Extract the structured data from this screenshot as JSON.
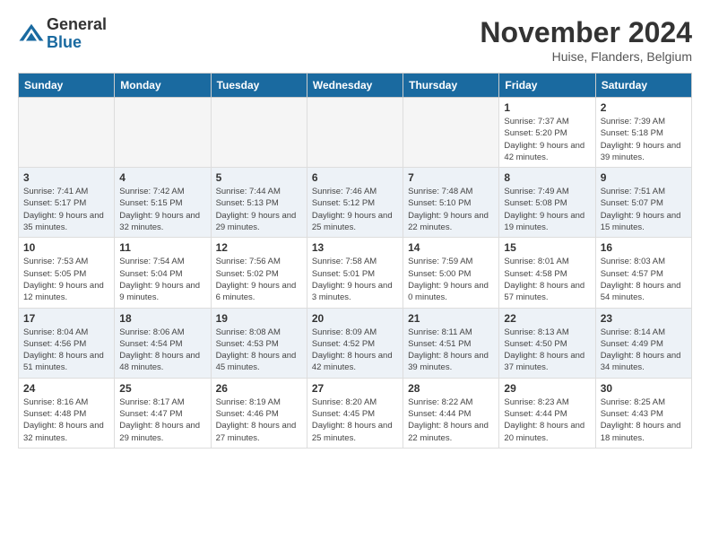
{
  "header": {
    "logo_general": "General",
    "logo_blue": "Blue",
    "month_year": "November 2024",
    "location": "Huise, Flanders, Belgium"
  },
  "weekdays": [
    "Sunday",
    "Monday",
    "Tuesday",
    "Wednesday",
    "Thursday",
    "Friday",
    "Saturday"
  ],
  "weeks": [
    [
      {
        "day": "",
        "info": ""
      },
      {
        "day": "",
        "info": ""
      },
      {
        "day": "",
        "info": ""
      },
      {
        "day": "",
        "info": ""
      },
      {
        "day": "",
        "info": ""
      },
      {
        "day": "1",
        "info": "Sunrise: 7:37 AM\nSunset: 5:20 PM\nDaylight: 9 hours and 42 minutes."
      },
      {
        "day": "2",
        "info": "Sunrise: 7:39 AM\nSunset: 5:18 PM\nDaylight: 9 hours and 39 minutes."
      }
    ],
    [
      {
        "day": "3",
        "info": "Sunrise: 7:41 AM\nSunset: 5:17 PM\nDaylight: 9 hours and 35 minutes."
      },
      {
        "day": "4",
        "info": "Sunrise: 7:42 AM\nSunset: 5:15 PM\nDaylight: 9 hours and 32 minutes."
      },
      {
        "day": "5",
        "info": "Sunrise: 7:44 AM\nSunset: 5:13 PM\nDaylight: 9 hours and 29 minutes."
      },
      {
        "day": "6",
        "info": "Sunrise: 7:46 AM\nSunset: 5:12 PM\nDaylight: 9 hours and 25 minutes."
      },
      {
        "day": "7",
        "info": "Sunrise: 7:48 AM\nSunset: 5:10 PM\nDaylight: 9 hours and 22 minutes."
      },
      {
        "day": "8",
        "info": "Sunrise: 7:49 AM\nSunset: 5:08 PM\nDaylight: 9 hours and 19 minutes."
      },
      {
        "day": "9",
        "info": "Sunrise: 7:51 AM\nSunset: 5:07 PM\nDaylight: 9 hours and 15 minutes."
      }
    ],
    [
      {
        "day": "10",
        "info": "Sunrise: 7:53 AM\nSunset: 5:05 PM\nDaylight: 9 hours and 12 minutes."
      },
      {
        "day": "11",
        "info": "Sunrise: 7:54 AM\nSunset: 5:04 PM\nDaylight: 9 hours and 9 minutes."
      },
      {
        "day": "12",
        "info": "Sunrise: 7:56 AM\nSunset: 5:02 PM\nDaylight: 9 hours and 6 minutes."
      },
      {
        "day": "13",
        "info": "Sunrise: 7:58 AM\nSunset: 5:01 PM\nDaylight: 9 hours and 3 minutes."
      },
      {
        "day": "14",
        "info": "Sunrise: 7:59 AM\nSunset: 5:00 PM\nDaylight: 9 hours and 0 minutes."
      },
      {
        "day": "15",
        "info": "Sunrise: 8:01 AM\nSunset: 4:58 PM\nDaylight: 8 hours and 57 minutes."
      },
      {
        "day": "16",
        "info": "Sunrise: 8:03 AM\nSunset: 4:57 PM\nDaylight: 8 hours and 54 minutes."
      }
    ],
    [
      {
        "day": "17",
        "info": "Sunrise: 8:04 AM\nSunset: 4:56 PM\nDaylight: 8 hours and 51 minutes."
      },
      {
        "day": "18",
        "info": "Sunrise: 8:06 AM\nSunset: 4:54 PM\nDaylight: 8 hours and 48 minutes."
      },
      {
        "day": "19",
        "info": "Sunrise: 8:08 AM\nSunset: 4:53 PM\nDaylight: 8 hours and 45 minutes."
      },
      {
        "day": "20",
        "info": "Sunrise: 8:09 AM\nSunset: 4:52 PM\nDaylight: 8 hours and 42 minutes."
      },
      {
        "day": "21",
        "info": "Sunrise: 8:11 AM\nSunset: 4:51 PM\nDaylight: 8 hours and 39 minutes."
      },
      {
        "day": "22",
        "info": "Sunrise: 8:13 AM\nSunset: 4:50 PM\nDaylight: 8 hours and 37 minutes."
      },
      {
        "day": "23",
        "info": "Sunrise: 8:14 AM\nSunset: 4:49 PM\nDaylight: 8 hours and 34 minutes."
      }
    ],
    [
      {
        "day": "24",
        "info": "Sunrise: 8:16 AM\nSunset: 4:48 PM\nDaylight: 8 hours and 32 minutes."
      },
      {
        "day": "25",
        "info": "Sunrise: 8:17 AM\nSunset: 4:47 PM\nDaylight: 8 hours and 29 minutes."
      },
      {
        "day": "26",
        "info": "Sunrise: 8:19 AM\nSunset: 4:46 PM\nDaylight: 8 hours and 27 minutes."
      },
      {
        "day": "27",
        "info": "Sunrise: 8:20 AM\nSunset: 4:45 PM\nDaylight: 8 hours and 25 minutes."
      },
      {
        "day": "28",
        "info": "Sunrise: 8:22 AM\nSunset: 4:44 PM\nDaylight: 8 hours and 22 minutes."
      },
      {
        "day": "29",
        "info": "Sunrise: 8:23 AM\nSunset: 4:44 PM\nDaylight: 8 hours and 20 minutes."
      },
      {
        "day": "30",
        "info": "Sunrise: 8:25 AM\nSunset: 4:43 PM\nDaylight: 8 hours and 18 minutes."
      }
    ]
  ]
}
